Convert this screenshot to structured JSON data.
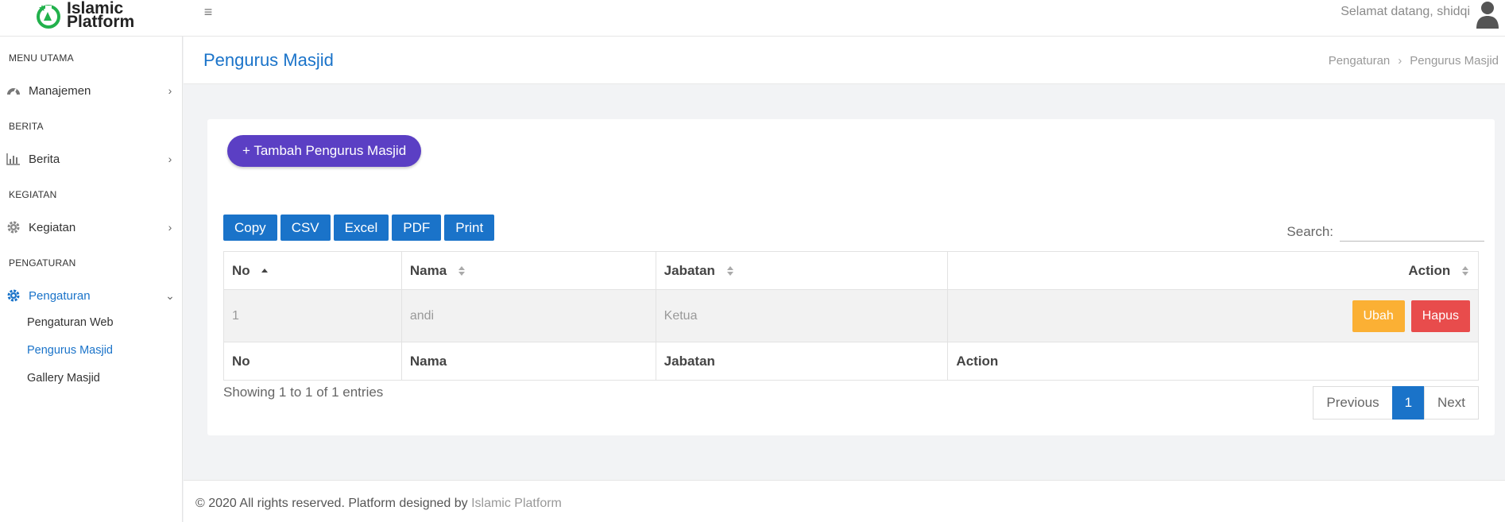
{
  "app": {
    "logo_line1": "Islamic",
    "logo_line2": "Platform",
    "welcome": "Selamat datang, shidqi"
  },
  "sidebar": {
    "sections": [
      {
        "heading": "MENU UTAMA",
        "item": {
          "label": "Manajemen",
          "icon": "dashboard-icon",
          "chevron": "›"
        }
      },
      {
        "heading": "BERITA",
        "item": {
          "label": "Berita",
          "icon": "bar-chart-icon",
          "chevron": "›"
        }
      },
      {
        "heading": "KEGIATAN",
        "item": {
          "label": "Kegiatan",
          "icon": "gear-icon",
          "chevron": "›"
        }
      },
      {
        "heading": "PENGATURAN",
        "item": {
          "label": "Pengaturan",
          "icon": "gear-icon",
          "chevron": "⌄"
        }
      }
    ],
    "sub_items": [
      "Pengaturan Web",
      "Pengurus Masjid",
      "Gallery Masjid"
    ]
  },
  "page": {
    "title": "Pengurus Masjid",
    "breadcrumb": [
      "Pengaturan",
      "Pengurus Masjid"
    ],
    "breadcrumb_sep": "›"
  },
  "toolbar": {
    "add_label": "+ Tambah Pengurus Masjid",
    "export_buttons": [
      "Copy",
      "CSV",
      "Excel",
      "PDF",
      "Print"
    ],
    "search_label": "Search:",
    "search_value": ""
  },
  "table": {
    "headers": [
      "No",
      "Nama",
      "Jabatan",
      "Action"
    ],
    "rows": [
      {
        "no": "1",
        "nama": "andi",
        "jabatan": "Ketua",
        "edit_label": "Ubah",
        "delete_label": "Hapus"
      }
    ],
    "footers": [
      "No",
      "Nama",
      "Jabatan",
      "Action"
    ],
    "info": "Showing 1 to 1 of 1 entries",
    "pagination": {
      "previous": "Previous",
      "current": "1",
      "next": "Next"
    }
  },
  "footer": {
    "text": "© 2020 All rights reserved. Platform designed by ",
    "brand": "Islamic Platform"
  },
  "colors": {
    "primary": "#1a73c9",
    "add_button": "#5b3fc4",
    "edit_button": "#fbb034",
    "delete_button": "#e84c4c"
  }
}
